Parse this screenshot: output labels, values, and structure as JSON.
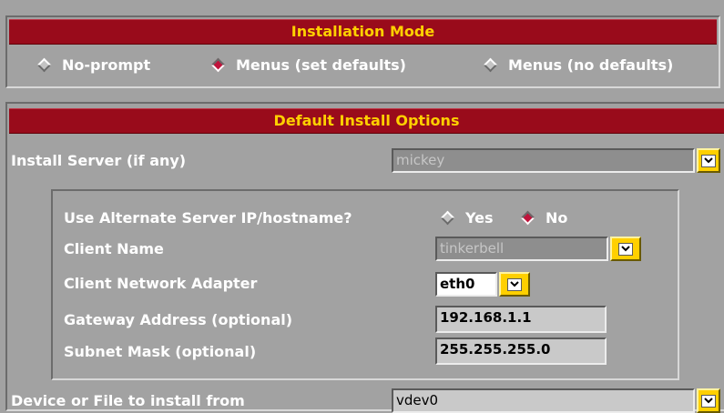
{
  "installation_mode": {
    "title": "Installation Mode",
    "options": [
      {
        "label": "No-prompt",
        "selected": false
      },
      {
        "label": "Menus (set defaults)",
        "selected": true
      },
      {
        "label": "Menus (no defaults)",
        "selected": false
      }
    ]
  },
  "default_install_options": {
    "title": "Default Install Options",
    "install_server": {
      "label": "Install Server (if any)",
      "value": "mickey"
    },
    "alternate_server": {
      "label": "Use Alternate Server IP/hostname?",
      "yes_label": "Yes",
      "no_label": "No",
      "selected": "No"
    },
    "client_name": {
      "label": "Client Name",
      "value": "tinkerbell"
    },
    "client_adapter": {
      "label": "Client Network Adapter",
      "value": "eth0"
    },
    "gateway": {
      "label": "Gateway Address (optional)",
      "value": "192.168.1.1"
    },
    "subnet": {
      "label": "Subnet Mask (optional)",
      "value": "255.255.255.0"
    },
    "device": {
      "label": "Device or File to install from",
      "value": "vdev0"
    }
  },
  "colors": {
    "title_bg": "#990b1b",
    "title_text": "#ffd000",
    "panel_bg": "#a2a2a2",
    "radio_selected": "#c0143c"
  },
  "icons": {
    "dropdown": "chevron-down-icon",
    "radio": "diamond-radio-icon"
  }
}
